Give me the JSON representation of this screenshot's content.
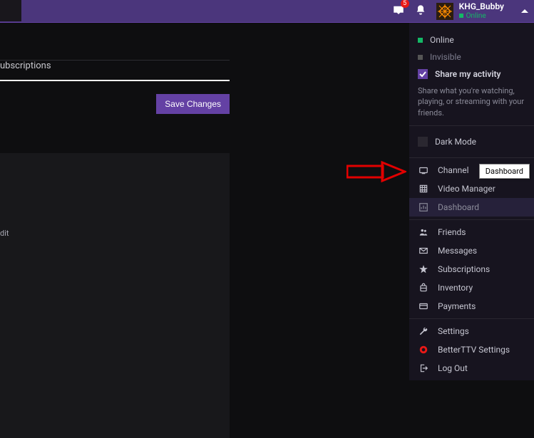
{
  "topbar": {
    "inbox_badge": "5",
    "username": "KHG_Bubby",
    "status": "Online"
  },
  "left": {
    "section_title": "ubscriptions",
    "save_button": "Save Changes",
    "edit_label": "dit"
  },
  "dropdown": {
    "status": {
      "online": "Online",
      "invisible": "Invisible"
    },
    "share": {
      "label": "Share my activity",
      "desc": "Share what you're watching, playing, or streaming with your friends."
    },
    "darkmode": "Dark Mode",
    "group1": [
      "Channel",
      "Video Manager",
      "Dashboard"
    ],
    "group2": [
      "Friends",
      "Messages",
      "Subscriptions",
      "Inventory",
      "Payments"
    ],
    "group3": [
      "Settings",
      "BetterTTV Settings",
      "Log Out"
    ]
  },
  "tooltip": "Dashboard"
}
